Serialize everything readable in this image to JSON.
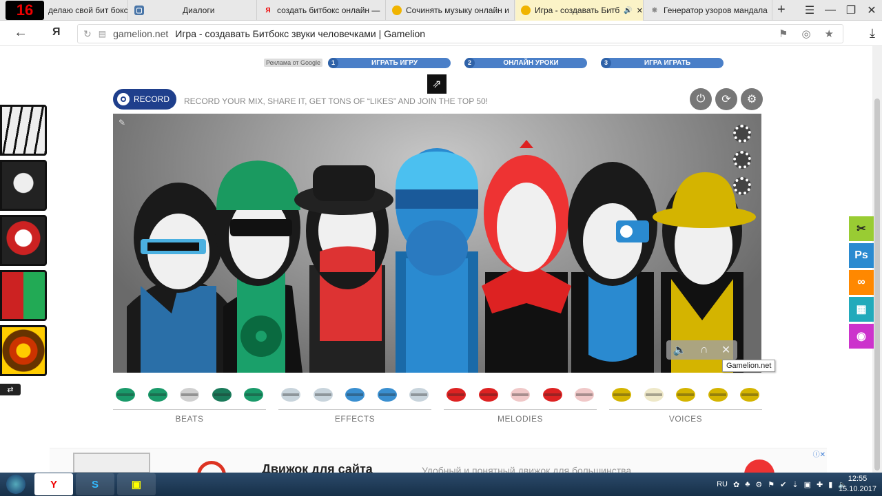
{
  "browser": {
    "tabs": [
      {
        "label": "делаю свой бит бокс",
        "favicon": "16",
        "color": "#c00"
      },
      {
        "label": "Диалоги",
        "favicon": "vk",
        "color": "#4a76a8"
      },
      {
        "label": "создать битбокс онлайн —",
        "favicon": "Я",
        "color": "#e00"
      },
      {
        "label": "Сочинять музыку онлайн и",
        "favicon": "smile",
        "color": "#f0b400"
      },
      {
        "label": "Игра - создавать Битб",
        "favicon": "smile",
        "color": "#f0b400",
        "active": true
      },
      {
        "label": "Генератор узоров мандала",
        "favicon": "mandala",
        "color": "#888"
      }
    ],
    "new_tab": "+",
    "address": {
      "domain": "gamelion.net",
      "title": "Игра - создавать Битбокс звуки человечками | Gamelion"
    }
  },
  "ad_links": {
    "adchoices": "Реклама от Google",
    "buttons": [
      {
        "num": "1",
        "label": "ИГРАТЬ ИГРУ"
      },
      {
        "num": "2",
        "label": "ОНЛАЙН УРОКИ"
      },
      {
        "num": "3",
        "label": "ИГРА ИГРАТЬ"
      }
    ]
  },
  "game": {
    "record_label": "RECORD",
    "slogan": "RECORD YOUR MIX, SHARE IT, GET TONS OF “LIKES” AND JOIN THE TOP 50!",
    "tooltip": "Gamelion.net",
    "palette": [
      {
        "label": "BEATS",
        "colors": [
          "#1a9a6a",
          "#1a9a6a",
          "#d0d0d0",
          "#1a7a5a",
          "#1a9a6a"
        ]
      },
      {
        "label": "EFFECTS",
        "colors": [
          "#c8d4dc",
          "#c8d4dc",
          "#3a8fd0",
          "#3a8fd0",
          "#c8d4dc"
        ]
      },
      {
        "label": "MELODIES",
        "colors": [
          "#d22",
          "#d22",
          "#f0c8c8",
          "#d22",
          "#f0c8c8"
        ]
      },
      {
        "label": "VOICES",
        "colors": [
          "#d4b400",
          "#eee8c8",
          "#d4b400",
          "#d4b400",
          "#d4b400"
        ]
      }
    ]
  },
  "ad_banner": {
    "headline": "Движок для сайта",
    "subtext": "Удобный и понятный движок для большинства"
  },
  "taskbar": {
    "lang": "RU",
    "time": "12:55",
    "date": "15.10.2017"
  }
}
